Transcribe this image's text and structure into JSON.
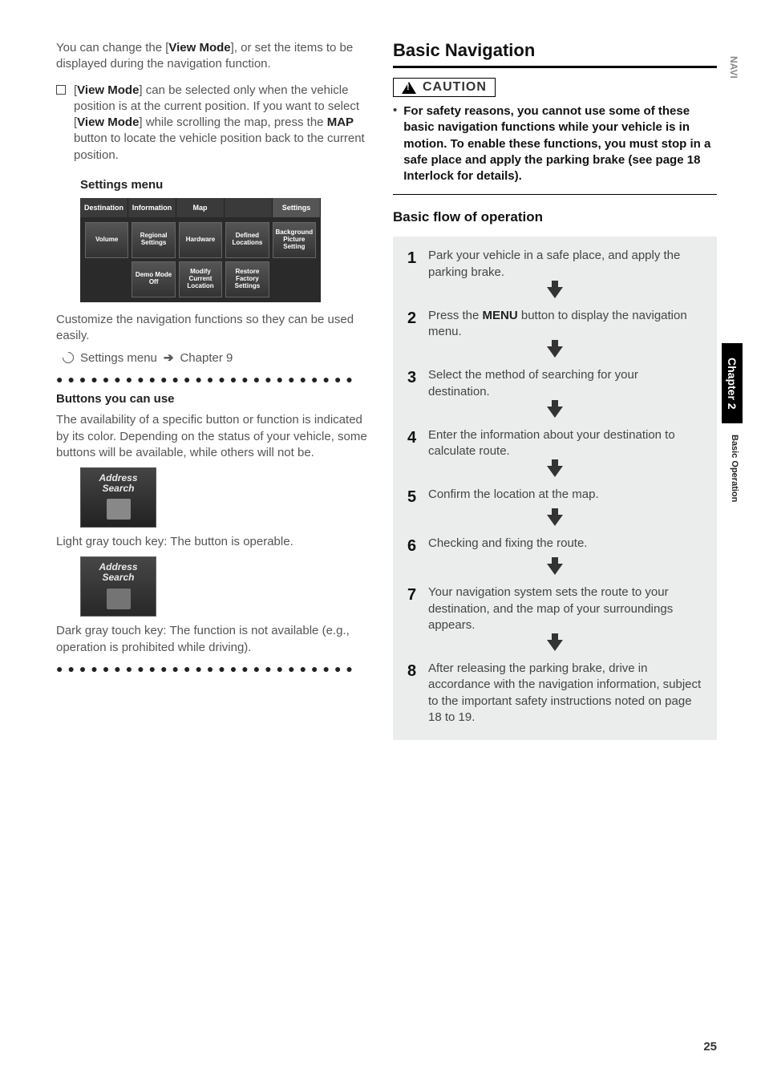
{
  "side": {
    "navi": "NAVI",
    "chapter": "Chapter 2",
    "section": "Basic Operation"
  },
  "page_number": "25",
  "left": {
    "intro": "You can change the [View Mode], or set the items to be displayed during the navigation function.",
    "view_mode_label": "View Mode",
    "note_part1": "[",
    "note_part2": "] can be selected only when the vehicle position is at the current position. If you want to select [",
    "note_part3": "] while scrolling the map, press the ",
    "map_label": "MAP",
    "note_part4": " button to locate the vehicle position back to the current position.",
    "settings_menu_heading": "Settings menu",
    "settings_tabs": [
      "Destination",
      "Information",
      "Map",
      "",
      "Settings"
    ],
    "settings_buttons": [
      "Volume",
      "Regional Settings",
      "Hardware",
      "Defined Locations",
      "Background Picture Setting",
      "",
      "Demo Mode Off",
      "Modify Current Location",
      "Restore Factory Settings",
      ""
    ],
    "customize_text": "Customize the navigation functions so they can be used easily.",
    "ref_prefix": "Settings menu",
    "ref_arrow": "➔",
    "ref_target": "Chapter 9",
    "buttons_heading": "Buttons you can use",
    "buttons_body": "The availability of a specific button or function is indicated by its color. Depending on the status of your vehicle, some buttons will be available, while others will not be.",
    "addr_label1": "Address",
    "addr_label2": "Search",
    "light_caption": "Light gray touch key: The button is operable.",
    "dark_caption": "Dark gray touch key: The function is not available (e.g., operation is prohibited while driving)."
  },
  "right": {
    "title": "Basic Navigation",
    "caution_label": "CAUTION",
    "caution_text": "For safety reasons, you cannot use some of these basic navigation functions while your vehicle is in motion. To enable these functions, you must stop in a safe place and apply the parking brake (see page 18 Interlock for details).",
    "flow_title": "Basic flow of operation",
    "steps": [
      {
        "n": "1",
        "t": "Park your vehicle in a safe place, and apply the parking brake."
      },
      {
        "n": "2",
        "t_pre": "Press the ",
        "t_bold": "MENU",
        "t_post": " button to display the navigation menu."
      },
      {
        "n": "3",
        "t": "Select the method of searching for your destination."
      },
      {
        "n": "4",
        "t": "Enter the information about your destination to calculate route."
      },
      {
        "n": "5",
        "t": "Confirm the location at the map."
      },
      {
        "n": "6",
        "t": "Checking and fixing the route."
      },
      {
        "n": "7",
        "t": "Your navigation system sets the route to your destination, and the map of your surroundings appears."
      },
      {
        "n": "8",
        "t": "After releasing the parking brake, drive in accordance with the navigation information, subject to the important safety instructions noted on page 18 to 19."
      }
    ]
  }
}
